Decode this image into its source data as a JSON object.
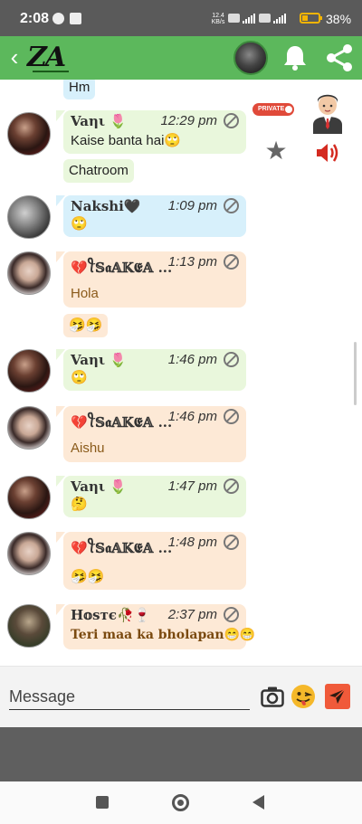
{
  "status_bar": {
    "time": "2:08",
    "net_speed": "12.4",
    "net_unit": "KB/s",
    "battery": "38%",
    "battery_level": 0.38
  },
  "app_bar": {
    "logo_text": "ZA"
  },
  "side_panel": {
    "private_badge": "PRIVATE"
  },
  "messages": [
    {
      "text": "Hm"
    },
    {
      "name": "Vaηι 🌷",
      "time": "12:29 pm",
      "text": "Kaise banta hai🙄"
    },
    {
      "text": "Chatroom"
    },
    {
      "name": "Nakshi🖤",
      "time": "1:09 pm",
      "text": "🙄"
    },
    {
      "name": "💔ꪻ𝕊𝖆𝔸𝕂𝕰𝔸 ...",
      "time": "1:13 pm",
      "text": "Hola"
    },
    {
      "text": "🤧🤧"
    },
    {
      "name": "Vaηι 🌷",
      "time": "1:46 pm",
      "text": "🙄"
    },
    {
      "name": "💔ꪻ𝕊𝖆𝔸𝕂𝕰𝔸 ...",
      "time": "1:46 pm",
      "text": "Aishu"
    },
    {
      "name": "Vaηι 🌷",
      "time": "1:47 pm",
      "text": "🤔"
    },
    {
      "name": "💔ꪻ𝕊𝖆𝔸𝕂𝕰𝔸 ...",
      "time": "1:48 pm",
      "text": "🤧🤧"
    },
    {
      "name": "H𝕠ѕтє🥀🍷",
      "time": "2:37 pm",
      "text": "Teri maa ka bholapan😁😁"
    }
  ],
  "composer": {
    "placeholder": "Message"
  }
}
